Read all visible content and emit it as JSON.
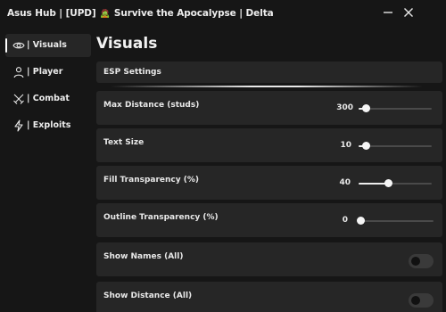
{
  "window": {
    "title_prefix": "Asus Hub | [UPD]",
    "title_emoji": "🧟",
    "title_suffix": "Survive the Apocalypse | Delta"
  },
  "sidebar": {
    "items": [
      {
        "label": "| Visuals",
        "icon": "eye-icon",
        "active": true
      },
      {
        "label": "| Player",
        "icon": "user-icon",
        "active": false
      },
      {
        "label": "| Combat",
        "icon": "crossed-swords-icon",
        "active": false
      },
      {
        "label": "| Exploits",
        "icon": "lightning-icon",
        "active": false
      }
    ]
  },
  "main": {
    "title": "Visuals",
    "section": "ESP Settings",
    "sliders": [
      {
        "label": "Max Distance (studs)",
        "value": "300",
        "fraction": 0.1
      },
      {
        "label": "Text Size",
        "value": "10",
        "fraction": 0.1
      },
      {
        "label": "Fill Transparency (%)",
        "value": "40",
        "fraction": 0.4
      },
      {
        "label": "Outline Transparency (%)",
        "value": "0",
        "fraction": 0.0
      }
    ],
    "toggles": [
      {
        "label": "Show Names (All)",
        "on": false
      },
      {
        "label": "Show Distance (All)",
        "on": false
      }
    ]
  },
  "colors": {
    "background": "#161616",
    "panel": "#262626",
    "accent": "#ffffff"
  }
}
